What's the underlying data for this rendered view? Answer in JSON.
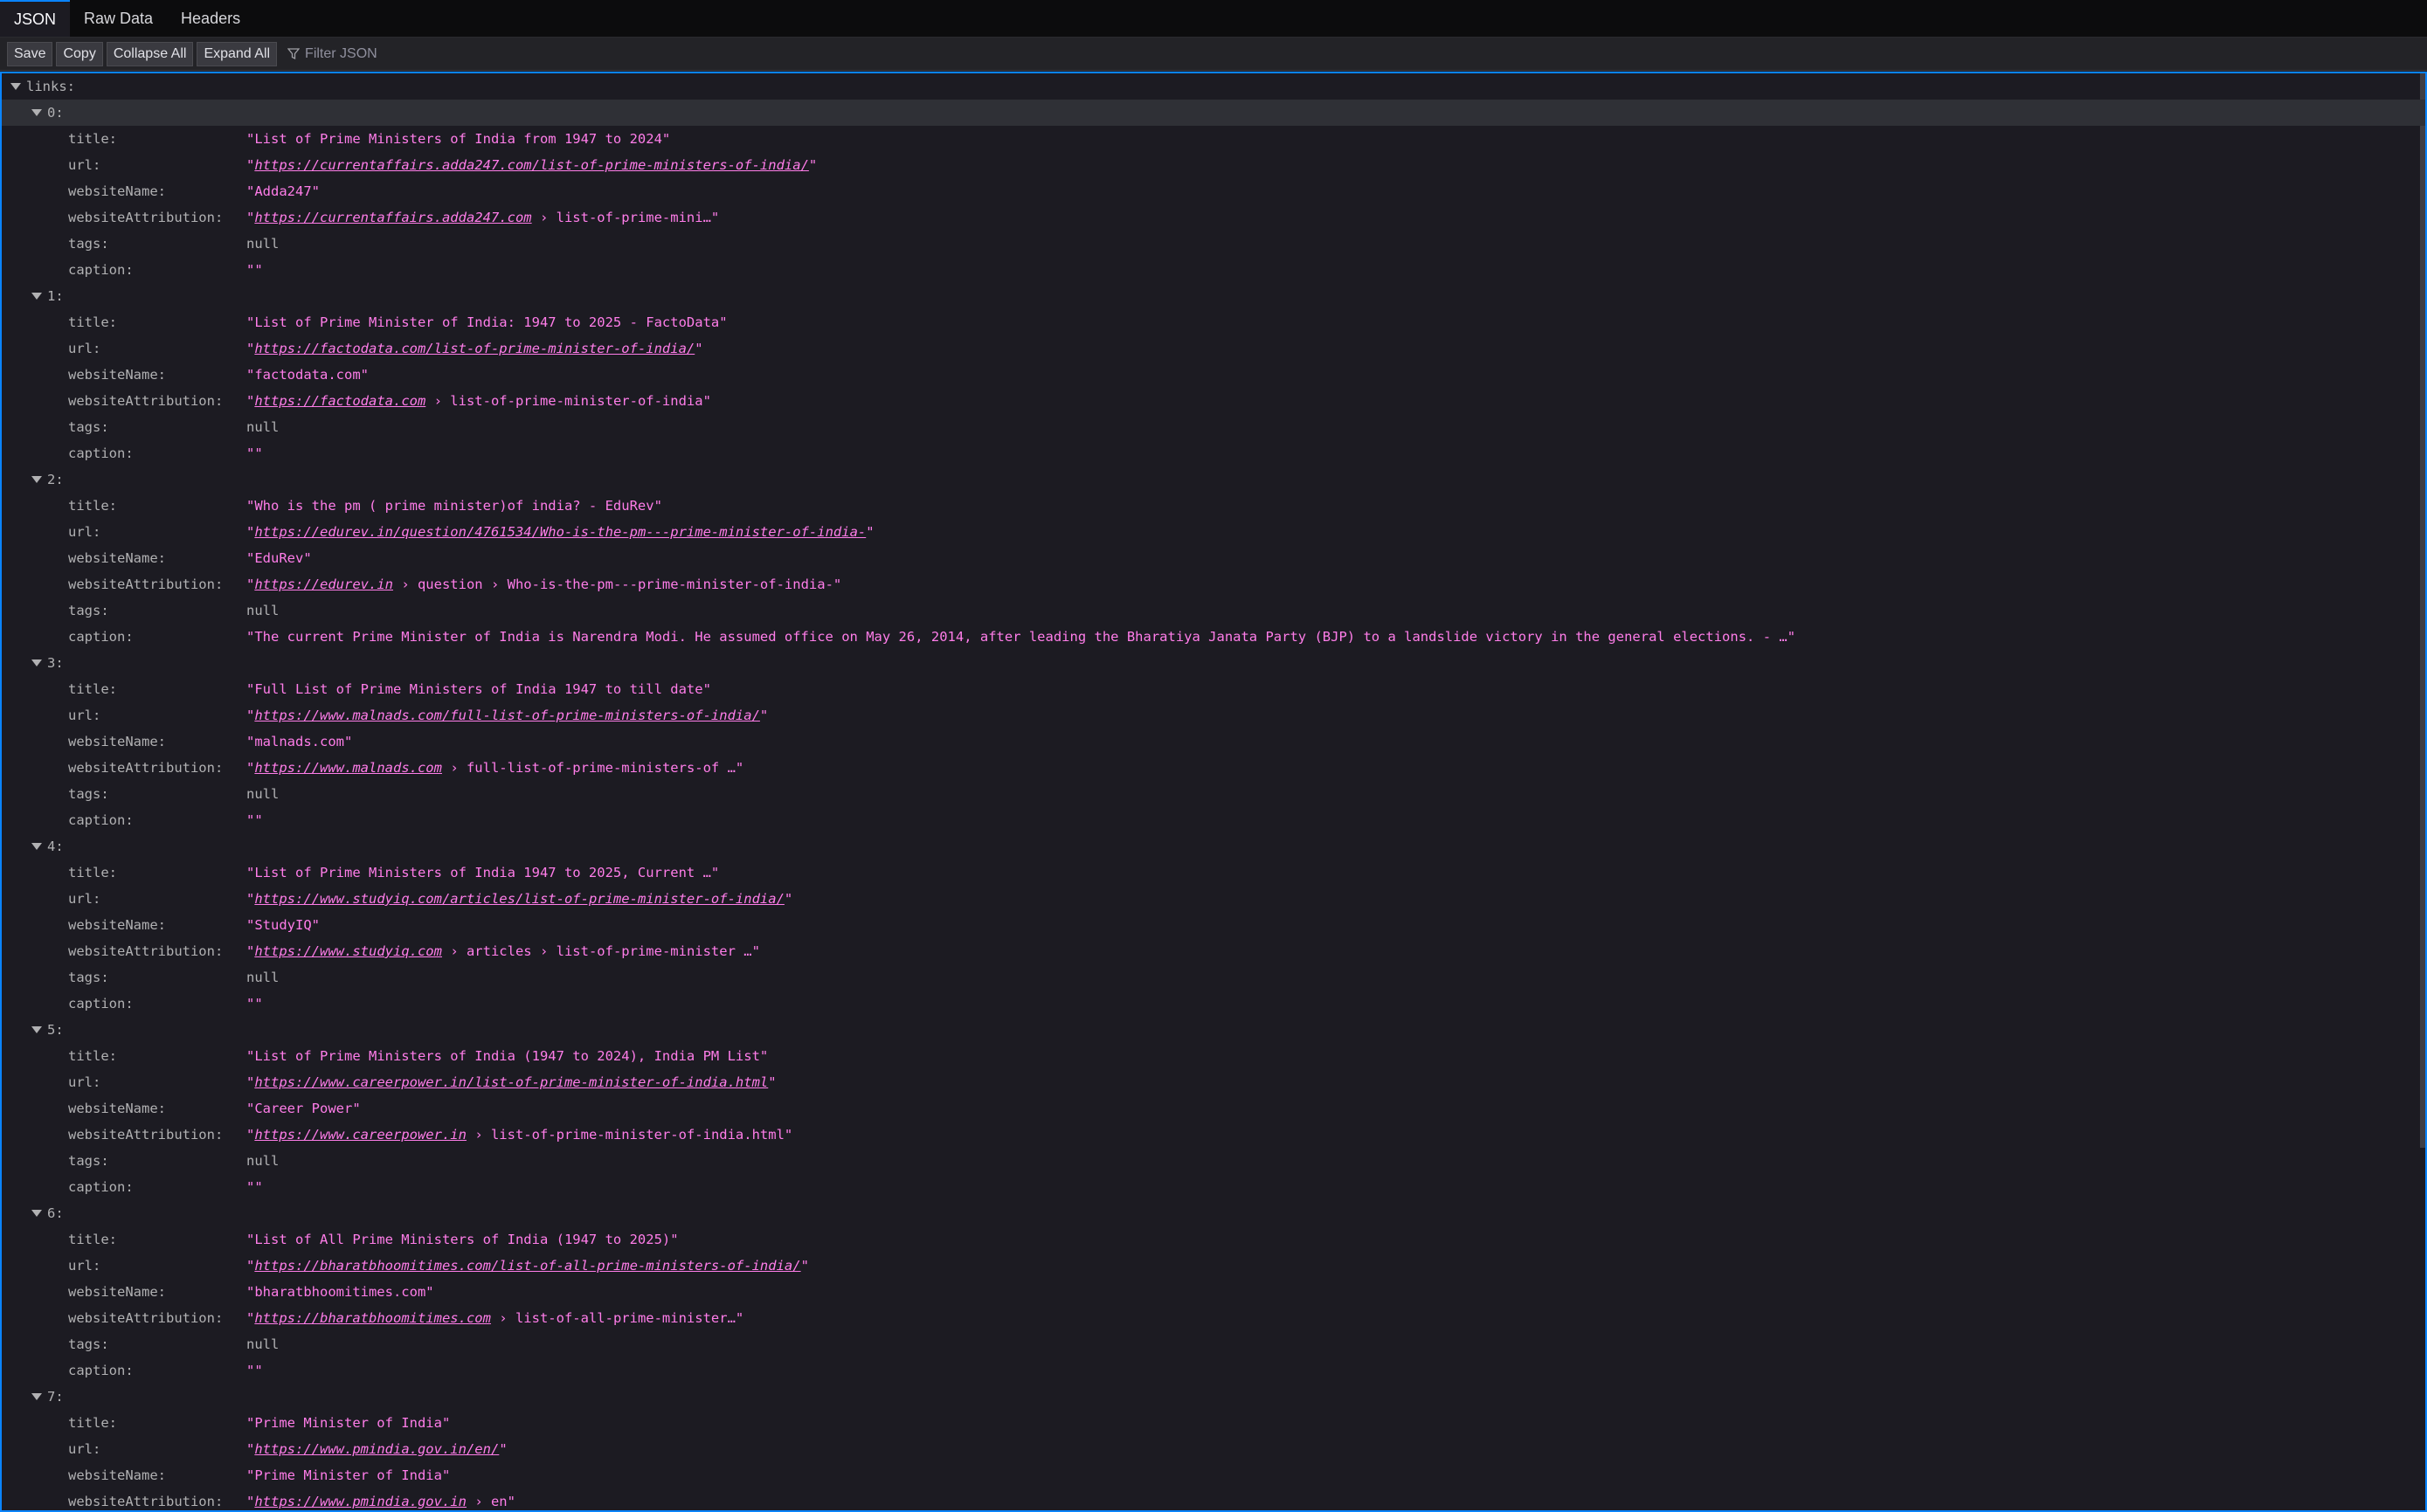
{
  "tabs": [
    "JSON",
    "Raw Data",
    "Headers"
  ],
  "toolbar": {
    "save": "Save",
    "copy": "Copy",
    "collapse_all": "Collapse All",
    "expand_all": "Expand All",
    "filter_placeholder": "Filter JSON"
  },
  "root_key": "links:",
  "items": [
    {
      "index": "0:",
      "title": "\"List of Prime Ministers of India from 1947 to 2024\"",
      "url": "https://currentaffairs.adda247.com/list-of-prime-ministers-of-india/",
      "websiteName": "\"Adda247\"",
      "attr_link": "https://currentaffairs.adda247.com",
      "attr_rest": " › list-of-prime-mini…\"",
      "tags": "null",
      "caption": "\"\""
    },
    {
      "index": "1:",
      "title": "\"List of Prime Minister of India: 1947 to 2025 - FactoData\"",
      "url": "https://factodata.com/list-of-prime-minister-of-india/",
      "websiteName": "\"factodata.com\"",
      "attr_link": "https://factodata.com",
      "attr_rest": " › list-of-prime-minister-of-india\"",
      "tags": "null",
      "caption": "\"\""
    },
    {
      "index": "2:",
      "title": "\"Who is the pm ( prime minister)of india? - EduRev\"",
      "url": "https://edurev.in/question/4761534/Who-is-the-pm---prime-minister-of-india-",
      "websiteName": "\"EduRev\"",
      "attr_link": "https://edurev.in",
      "attr_rest": " › question › Who-is-the-pm---prime-minister-of-india-\"",
      "tags": "null",
      "caption": "\"The current Prime Minister of India is Narendra Modi. He assumed office on May 26, 2014, after leading the Bharatiya Janata Party (BJP) to a landslide victory in the general elections. - …\""
    },
    {
      "index": "3:",
      "title": "\"Full List of Prime Ministers of India 1947 to till date\"",
      "url": "https://www.malnads.com/full-list-of-prime-ministers-of-india/",
      "websiteName": "\"malnads.com\"",
      "attr_link": "https://www.malnads.com",
      "attr_rest": " › full-list-of-prime-ministers-of …\"",
      "tags": "null",
      "caption": "\"\""
    },
    {
      "index": "4:",
      "title": "\"List of Prime Ministers of India 1947 to 2025, Current …\"",
      "url": "https://www.studyiq.com/articles/list-of-prime-minister-of-india/",
      "websiteName": "\"StudyIQ\"",
      "attr_link": "https://www.studyiq.com",
      "attr_rest": " › articles › list-of-prime-minister …\"",
      "tags": "null",
      "caption": "\"\""
    },
    {
      "index": "5:",
      "title": "\"List of Prime Ministers of India (1947 to 2024), India PM List\"",
      "url": "https://www.careerpower.in/list-of-prime-minister-of-india.html",
      "websiteName": "\"Career Power\"",
      "attr_link": "https://www.careerpower.in",
      "attr_rest": " › list-of-prime-minister-of-india.html\"",
      "tags": "null",
      "caption": "\"\""
    },
    {
      "index": "6:",
      "title": "\"List of All Prime Ministers of India (1947 to 2025)\"",
      "url": "https://bharatbhoomitimes.com/list-of-all-prime-ministers-of-india/",
      "websiteName": "\"bharatbhoomitimes.com\"",
      "attr_link": "https://bharatbhoomitimes.com",
      "attr_rest": " › list-of-all-prime-minister…\"",
      "tags": "null",
      "caption": "\"\""
    },
    {
      "index": "7:",
      "title": "\"Prime Minister of India\"",
      "url": "https://www.pmindia.gov.in/en/",
      "websiteName": "\"Prime Minister of India\"",
      "attr_link": "https://www.pmindia.gov.in",
      "attr_rest": " › en\"",
      "tags": null,
      "caption": null
    }
  ],
  "prop_labels": {
    "title": "title:",
    "url": "url:",
    "websiteName": "websiteName:",
    "websiteAttribution": "websiteAttribution:",
    "tags": "tags:",
    "caption": "caption:"
  },
  "quote": "\""
}
